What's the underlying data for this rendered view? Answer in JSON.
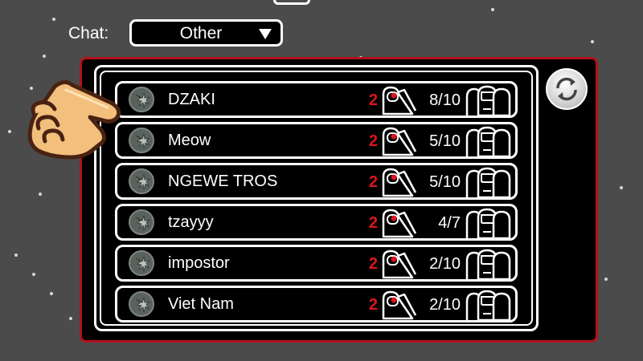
{
  "filter": {
    "chat_label": "Chat:",
    "chat_value": "Other"
  },
  "lobbies": [
    {
      "host": "DZAKI",
      "impostors": "2",
      "players": "8/10"
    },
    {
      "host": "Meow",
      "impostors": "2",
      "players": "5/10"
    },
    {
      "host": "NGEWE TROS",
      "impostors": "2",
      "players": "5/10"
    },
    {
      "host": "tzayyy",
      "impostors": "2",
      "players": "4/7"
    },
    {
      "host": "impostor",
      "impostors": "2",
      "players": "2/10"
    },
    {
      "host": "Viet Nam",
      "impostors": "2",
      "players": "2/10"
    }
  ],
  "icons": {
    "refresh": "refresh-icon",
    "dropdown": "chevron-down-icon",
    "impostor": "impostor-crewmate-icon",
    "players": "crewmates-icon",
    "host_map": "map-emblem-icon",
    "pointer": "pointing-hand-icon"
  },
  "colors": {
    "background": "#4b4b4b",
    "panel_border": "#b2121b",
    "impostor_red": "#e0141e",
    "row_fill": "#000000",
    "row_border": "#ffffff"
  }
}
